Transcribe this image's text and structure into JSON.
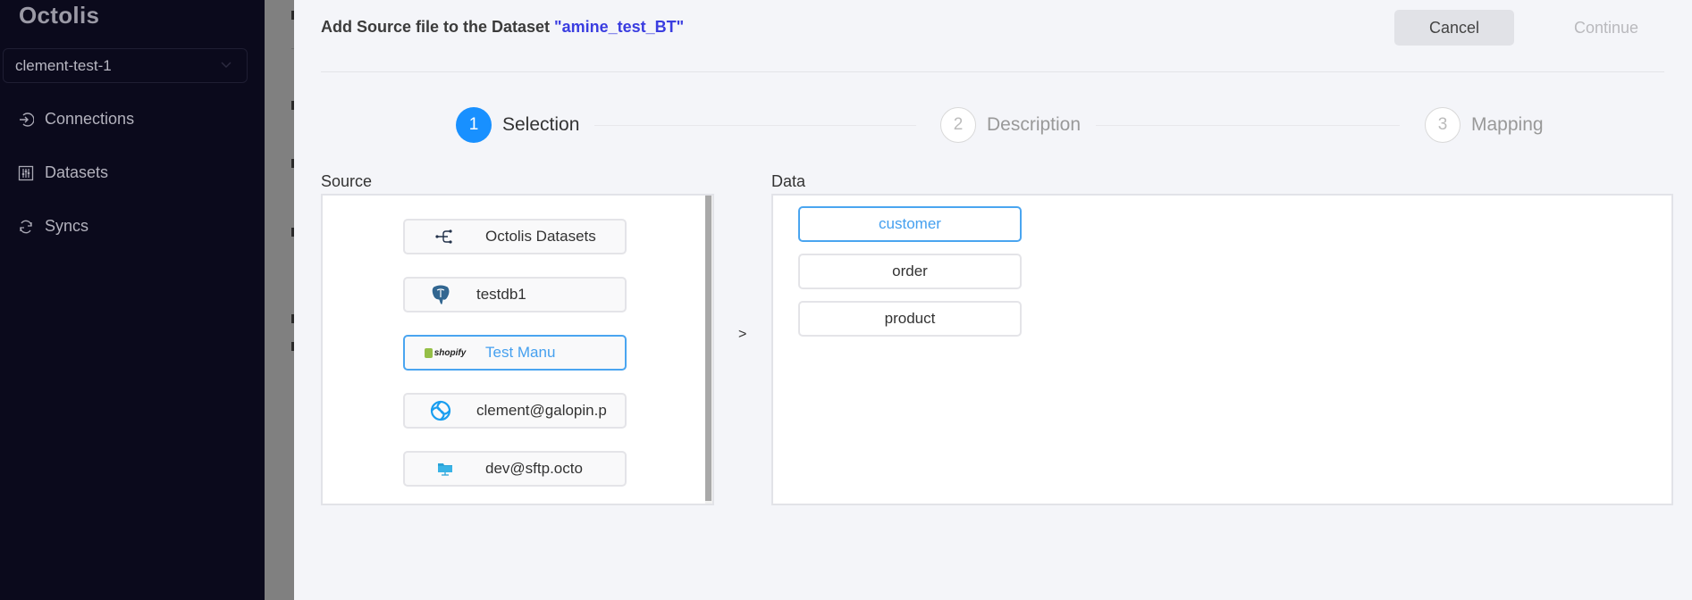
{
  "sidebar": {
    "logo": "Octolis",
    "workspace": "clement-test-1",
    "nav": [
      {
        "label": "Connections",
        "icon": "login-icon"
      },
      {
        "label": "Datasets",
        "icon": "sliders-icon"
      },
      {
        "label": "Syncs",
        "icon": "sync-icon"
      }
    ]
  },
  "modal": {
    "title_prefix": "Add Source file to the Dataset ",
    "dataset_name": "\"amine_test_BT\"",
    "cancel_label": "Cancel",
    "continue_label": "Continue",
    "steps": [
      {
        "number": "1",
        "label": "Selection",
        "state": "active"
      },
      {
        "number": "2",
        "label": "Description",
        "state": "inactive"
      },
      {
        "number": "3",
        "label": "Mapping",
        "state": "inactive"
      }
    ],
    "source_label": "Source",
    "data_label": "Data",
    "arrow": ">",
    "sources": [
      {
        "name": "Octolis Datasets",
        "icon": "octolis-datasets-icon",
        "selected": false
      },
      {
        "name": "testdb1",
        "icon": "postgresql-icon",
        "selected": false
      },
      {
        "name": "Test Manu",
        "icon": "shopify-icon",
        "selected": true,
        "icon_text": "shopify"
      },
      {
        "name": "clement@galopin.p",
        "icon": "sendinblue-icon",
        "selected": false
      },
      {
        "name": "dev@sftp.octo",
        "icon": "sftp-folder-icon",
        "selected": false
      }
    ],
    "data_items": [
      {
        "name": "customer",
        "selected": true
      },
      {
        "name": "order",
        "selected": false
      },
      {
        "name": "product",
        "selected": false
      }
    ]
  },
  "colors": {
    "sidebar_bg": "#0b0a1c",
    "accent": "#1890ff",
    "selected_border": "#4aa5f0",
    "dataset_name": "#3a3de0"
  }
}
